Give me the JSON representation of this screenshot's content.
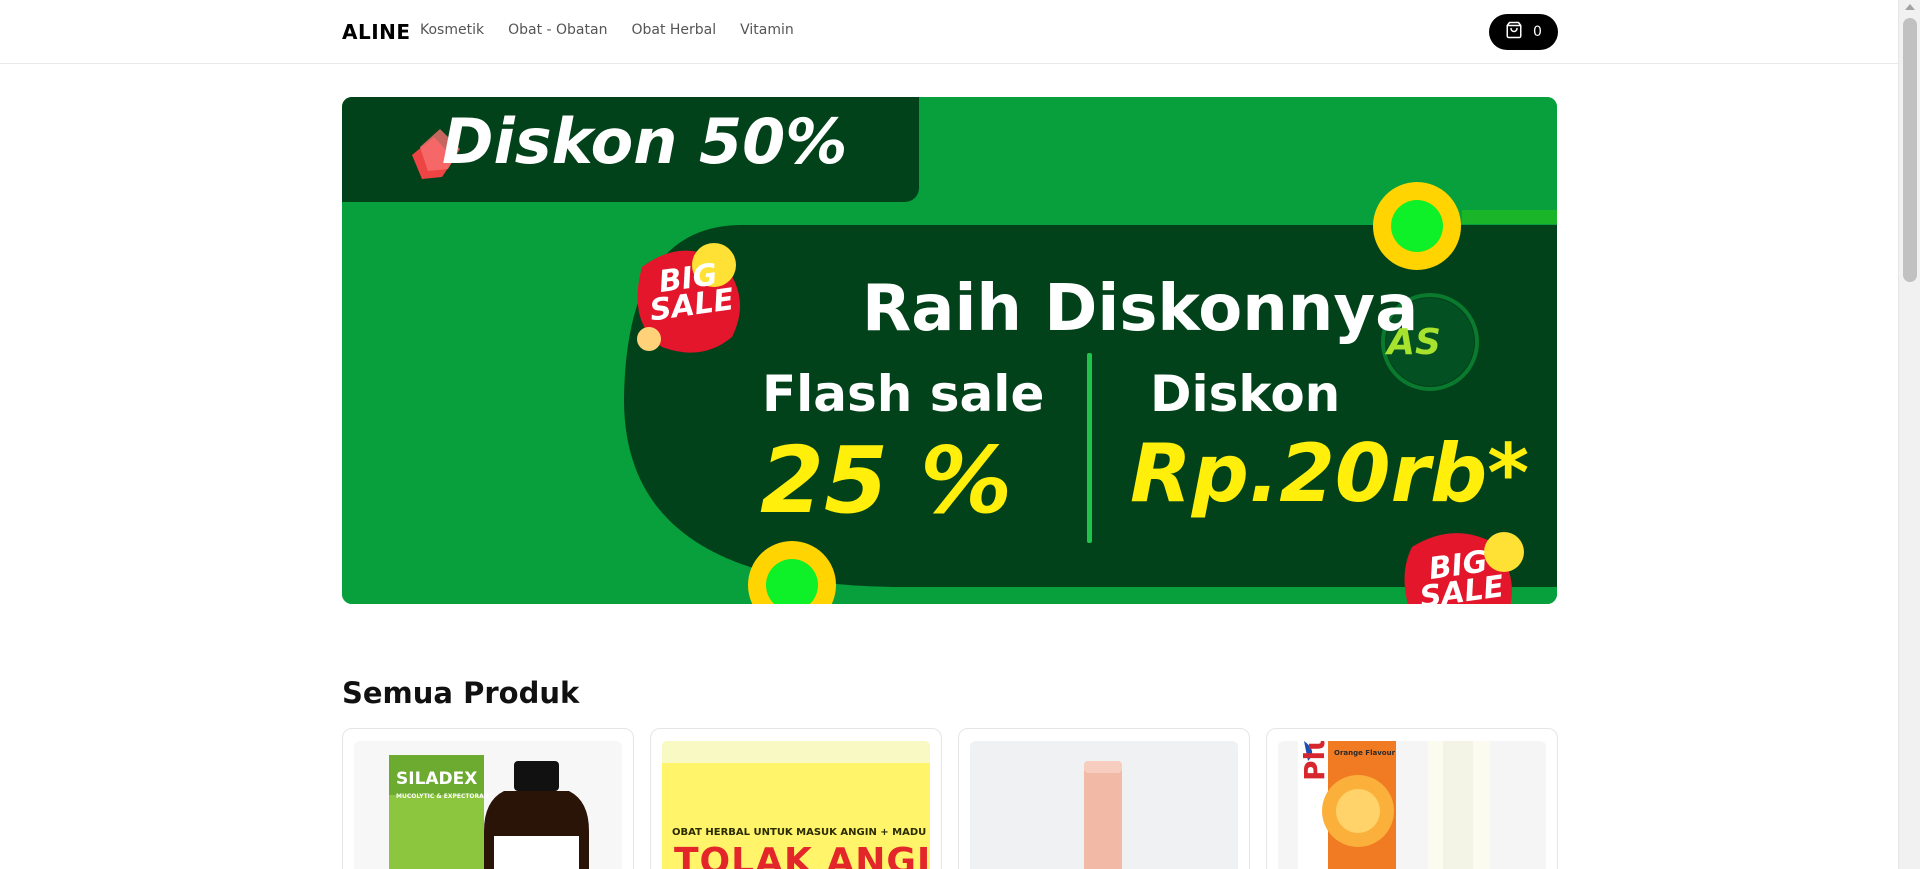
{
  "header": {
    "brand": "ALINE",
    "nav": [
      "Kosmetik",
      "Obat - Obatan",
      "Obat Herbal",
      "Vitamin"
    ],
    "cart_count": "0",
    "cart_icon": "shopping-bag-icon"
  },
  "banner": {
    "headline": "Diskon 50%",
    "subheadline": "Raih Diskonnya",
    "flash_label": "Flash sale",
    "flash_value": "25 %",
    "discount_label": "Diskon",
    "discount_value": "Rp.20rb*",
    "sale_badge": "BIG SALE",
    "logo_text": "AS",
    "colors": {
      "green": "#07a03c",
      "dark_green": "#02421a",
      "yellow": "#ffef0a",
      "red": "#e3162c"
    }
  },
  "section": {
    "title": "Semua Produk"
  },
  "products": [
    {
      "image_text": "SILADEX",
      "image_subtext": "MUCOLYTIC & EXPECTORANT"
    },
    {
      "image_text": "TOLAK ANGIN",
      "image_subtext": "OBAT HERBAL UNTUK MASUK ANGIN + MADU"
    },
    {
      "image_text": "",
      "image_subtext": ""
    },
    {
      "image_text": "Plus",
      "image_subtext": "Orange Flavour"
    }
  ]
}
